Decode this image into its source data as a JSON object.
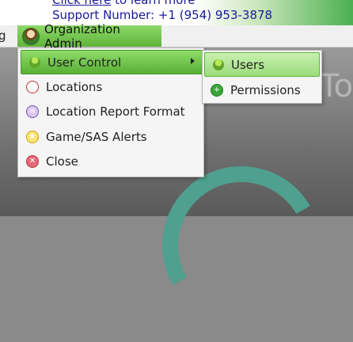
{
  "banner": {
    "link_text": "Click here",
    "line1_rest": " to learn more",
    "support": "Support Number: +1 (954) 953-3878"
  },
  "menubar": {
    "prev_fragment": "g",
    "org_admin": "Organization Admin"
  },
  "dropdown": {
    "items": [
      {
        "label": "User Control",
        "icon": "user-icon"
      },
      {
        "label": "Locations",
        "icon": "location-icon"
      },
      {
        "label": "Location Report Format",
        "icon": "report-icon"
      },
      {
        "label": "Game/SAS Alerts",
        "icon": "alert-icon"
      },
      {
        "label": "Close",
        "icon": "close-icon"
      }
    ]
  },
  "submenu": {
    "items": [
      {
        "label": "Users",
        "icon": "user-icon"
      },
      {
        "label": "Permissions",
        "icon": "plus-icon"
      }
    ]
  },
  "background": {
    "partial_text": "To"
  },
  "colors": {
    "accent_green": "#5fb43a",
    "link_blue": "#1a1a9a"
  }
}
